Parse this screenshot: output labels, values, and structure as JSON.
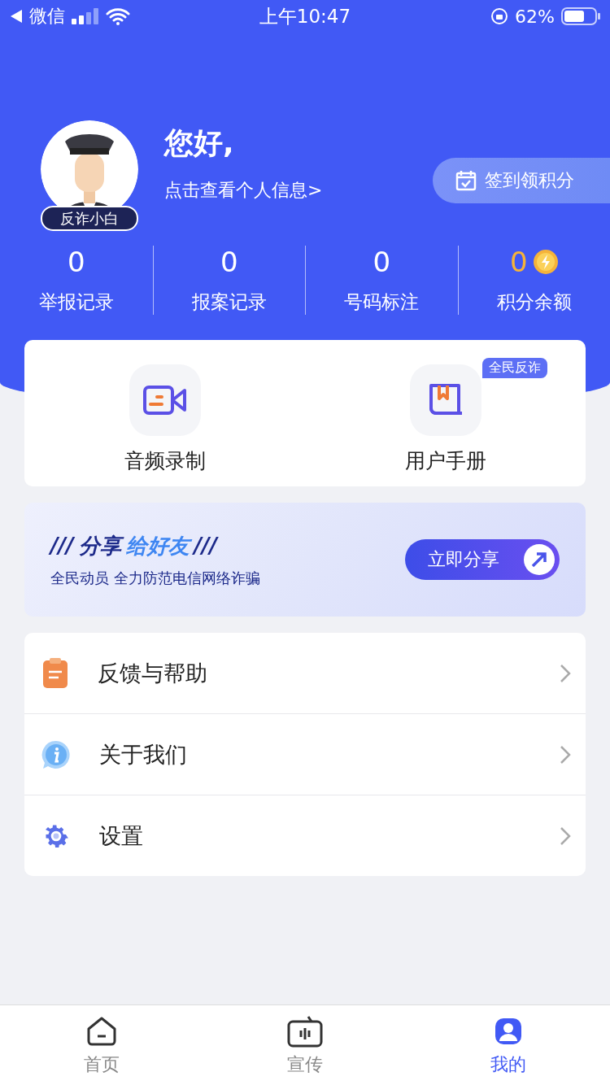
{
  "status_bar": {
    "back_label": "微信",
    "time": "上午10:47",
    "battery": "62%"
  },
  "profile": {
    "greeting": "您好,",
    "link": "点击查看个人信息>",
    "badge": "反诈小白",
    "checkin_button": "签到领积分"
  },
  "stats": [
    {
      "kind": "count",
      "value": "0",
      "label": "举报记录"
    },
    {
      "kind": "count",
      "value": "0",
      "label": "报案记录"
    },
    {
      "kind": "count",
      "value": "0",
      "label": "号码标注"
    },
    {
      "kind": "points",
      "value": "0",
      "label": "积分余额"
    }
  ],
  "shortcuts": [
    {
      "kind": "video",
      "label": "音频录制"
    },
    {
      "kind": "book",
      "label": "用户手册",
      "badge": "全民反诈"
    }
  ],
  "share_banner": {
    "prefix": "///",
    "title_dark": "分享",
    "title_light": "给好友",
    "suffix": "///",
    "subtitle": "全民动员 全力防范电信网络诈骗",
    "button": "立即分享"
  },
  "menu": [
    {
      "kind": "feedback",
      "label": "反馈与帮助"
    },
    {
      "kind": "about",
      "label": "关于我们"
    },
    {
      "kind": "settings",
      "label": "设置"
    }
  ],
  "tabs": [
    {
      "kind": "home",
      "label": "首页",
      "selected": false
    },
    {
      "kind": "tv",
      "label": "宣传",
      "selected": false
    },
    {
      "kind": "user",
      "label": "我的",
      "selected": true
    }
  ]
}
